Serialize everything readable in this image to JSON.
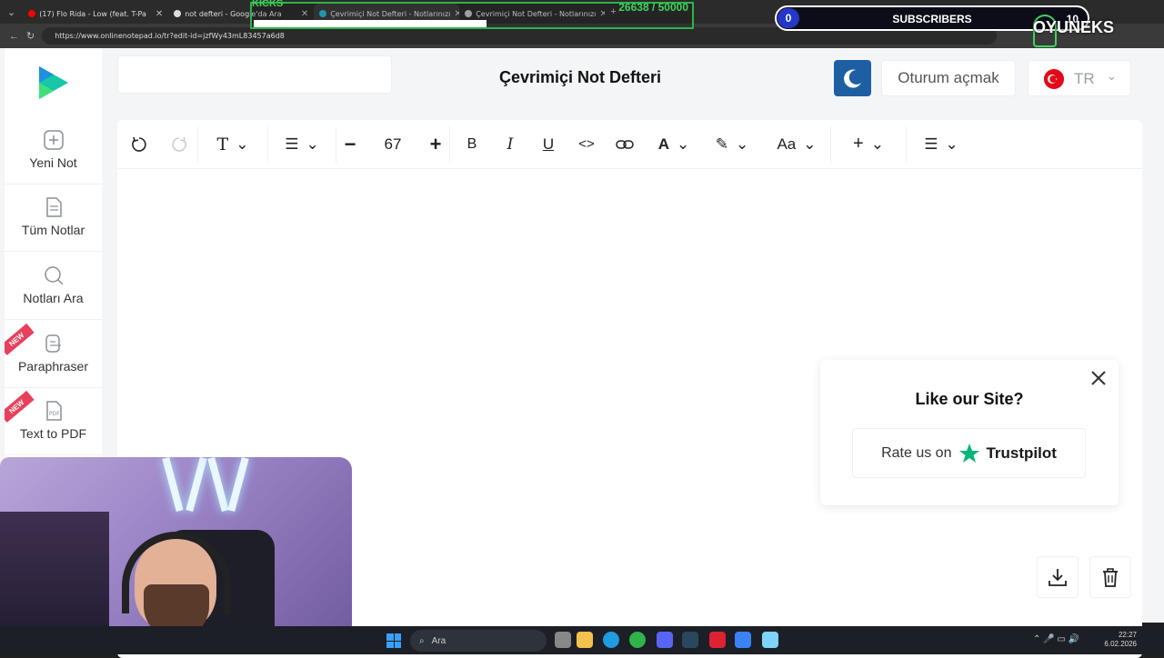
{
  "browser": {
    "tabs": [
      {
        "label": "(17) Flo Rida - Low (feat. T-Pa",
        "color": "#ff0000"
      },
      {
        "label": "not defteri - Google'da Ara",
        "color": "#dddddd"
      },
      {
        "label": "Çevrimiçi Not Defteri - Notlarınızı",
        "color": "#28b1c8"
      },
      {
        "label": "Çevrimiçi Not Defteri - Notlarınızı",
        "color": "#bbbbbb"
      }
    ],
    "url": "https://www.onlinenotepad.io/tr?edit-id=jzfWy43mL83457a6d8"
  },
  "overlay": {
    "kicks_label": "KICKS",
    "kicks_count": "26638  / 50000",
    "subscribers_label": "SUBSCRIBERS",
    "subscribers_current": "0",
    "subscribers_goal": "10",
    "brand": "OYUNEKS"
  },
  "header": {
    "title": "Çevrimiçi Not Defteri",
    "login_label": "Oturum açmak",
    "language": "TR",
    "accent": "#1e5fa3"
  },
  "sidebar": {
    "items": [
      {
        "label": "Yeni Not",
        "icon": "plus-square-icon"
      },
      {
        "label": "Tüm Notlar",
        "icon": "document-icon"
      },
      {
        "label": "Notları Ara",
        "icon": "search-icon"
      },
      {
        "label": "Paraphraser",
        "icon": "paraphrase-icon",
        "badge": "NEW"
      },
      {
        "label": "Text to PDF",
        "icon": "pdf-icon",
        "badge": "NEW"
      }
    ]
  },
  "toolbar": {
    "font_size": "67",
    "bold": "B",
    "italic": "I",
    "underline": "U",
    "text_color": "A",
    "case": "Aa"
  },
  "rate_card": {
    "title": "Like our Site?",
    "button_text": "Rate us on",
    "brand": "Trustpilot",
    "brand_color": "#00b67a"
  },
  "taskbar": {
    "search_placeholder": "Ara",
    "time": "22:27",
    "date": "6.02.2026"
  }
}
